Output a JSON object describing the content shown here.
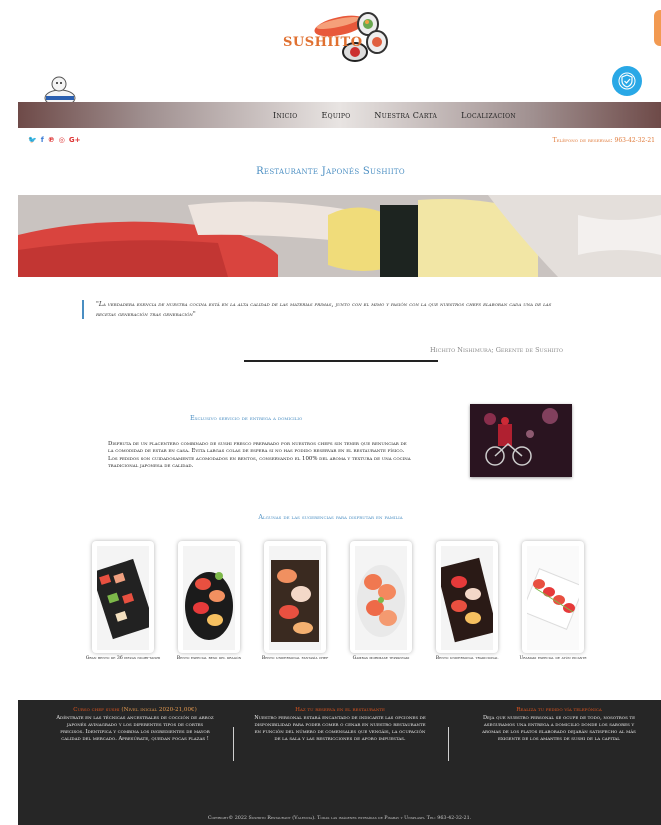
{
  "header": {
    "logo_text": "SUSHIITO",
    "colors": {
      "accent": "#4a8ec2",
      "orange": "#e07a3a",
      "footer_bg": "#262626"
    }
  },
  "nav": {
    "items": [
      {
        "label": "Inicio"
      },
      {
        "label": "Equipo"
      },
      {
        "label": "Nuestra Carta"
      },
      {
        "label": "Localizacion"
      }
    ]
  },
  "social": {
    "icons": [
      "twitter-icon",
      "facebook-icon",
      "pinterest-icon",
      "instagram-icon",
      "google-plus-icon"
    ]
  },
  "phone": {
    "text": "Teléfono de reservas: 963-42-32-21"
  },
  "page_title": "Restaurante Japonés Sushiito",
  "quote": {
    "text": "\"La verdadera esencia de nuestra cocina está en la alta calidad de las materias primas, junto con el mimo y pasión con la que nuestros chefs elaboran cada una de las recetas generación tras generación\"",
    "author": "Hichito Nishimura; Gerente de Sushiito"
  },
  "delivery": {
    "title": "Exclusivo servicio de entrega a domicilio",
    "text": "Disfruta de un placentero combinado de sushi fresco preparado por nuestros chefs sin tener que renunciar de la comodidad de estar en casa. Evita largas colas de espera si no has podido reservar en el restaurante físico. Los pedidos son cuidadosamente acomodados en bentos, conservando el 100% del aroma y textura de una cocina tradicional japonesa de calidad."
  },
  "suggestions": {
    "title": "Algunas de las sugerencias para disfrutar en familia",
    "items": [
      {
        "label": "Gran bento de 36 piezas nigiri-sushi"
      },
      {
        "label": "Bento especial beso del dragón"
      },
      {
        "label": "Bento unipersonal fantasía chef"
      },
      {
        "label": "Gambas morimase teppanyaki"
      },
      {
        "label": "Bento unipersonal tradicional"
      },
      {
        "label": "Uramaki especial de atún picante"
      }
    ]
  },
  "footer": {
    "col1": {
      "title": "Curso chef sushi",
      "highlight": "(Nivel inicial 2020-21,00€)",
      "text": "Adéntrate en las técnicas ancestrales de cocción de arroz japonés avinagrado y los diferentes tipos de cortes precisos. Identifica y combina los ingredientes de mayor calidad del mercado. Apresúrate, quedan pocas plazas !"
    },
    "col2": {
      "title": "Haz tu reserva en el restaurante",
      "text": "Nuestro personal estará encantado de indicarte las opciones de disponibilidad para poder comer o cenar en nuestro restaurante en función del número de comensales que vengáis, la ocupación de la sala y las restricciones de aforo impuestas."
    },
    "col3": {
      "title": "Realiza tu pedido vía telefónica",
      "text": "Deja que nuestro personal se ocupe de todo, nosotros te aseguramos una entrega a domicilio donde los sabores y aromas de los platos elaborado dejarán satisfecho al más exigente de los amantes de sushi de la capital"
    },
    "copyright": "Copyright© 2022 Sushiito Restaurant (Valencia). Todas las imágenes extraídas de Pixabay y Unsplash. Tel: 963-42-32-21."
  }
}
